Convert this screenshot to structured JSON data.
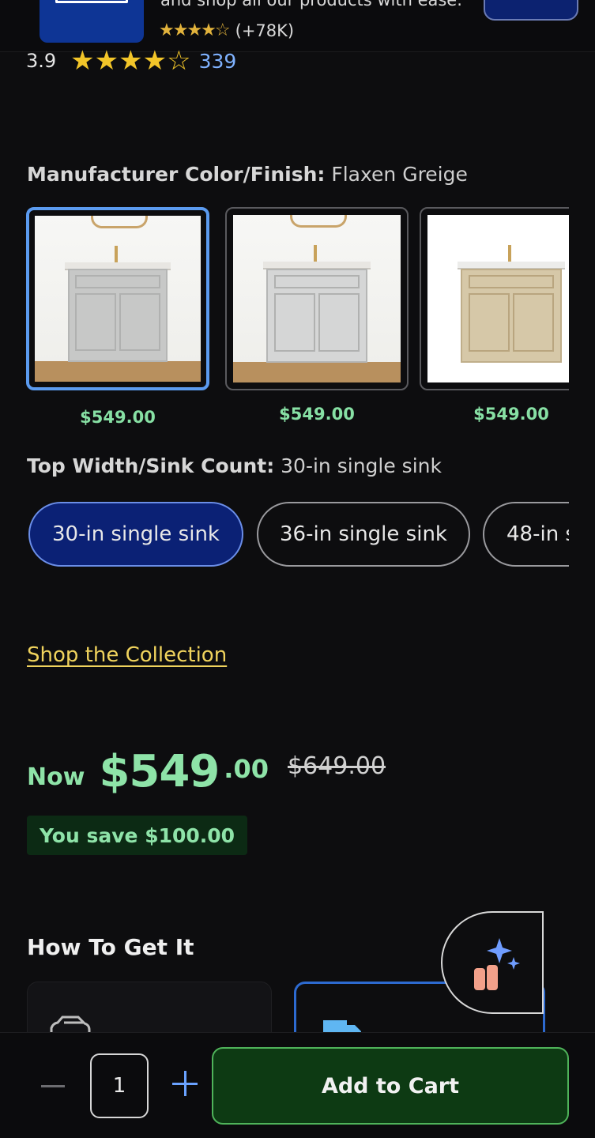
{
  "app_banner": {
    "text": "and shop all our products with ease.",
    "stars": "★★★★☆",
    "review_count": "(+78K)"
  },
  "rating": {
    "value": "3.9",
    "stars": "★★★★☆",
    "count": "339"
  },
  "color_finish": {
    "label": "Manufacturer Color/Finish:",
    "value": "Flaxen Greige",
    "options": [
      {
        "price": "$549.00",
        "selected": true
      },
      {
        "price": "$549.00",
        "selected": false
      },
      {
        "price": "$549.00",
        "selected": false
      }
    ]
  },
  "size": {
    "label": "Top Width/Sink Count:",
    "value": "30-in single sink",
    "options": [
      {
        "label": "30-in single sink",
        "selected": true
      },
      {
        "label": "36-in single sink",
        "selected": false
      },
      {
        "label": "48-in s",
        "selected": false
      }
    ]
  },
  "collection_link": "Shop the Collection",
  "price": {
    "now_label": "Now",
    "main": "$549",
    "cents": ".00",
    "was": "$649.00",
    "savings": "You save $100.00"
  },
  "fulfillment": {
    "title": "How To Get It"
  },
  "cart": {
    "quantity": "1",
    "add_label": "Add to Cart"
  },
  "colors": {
    "accent_price": "#8ee3a8",
    "link": "#f0d35d",
    "selected_pill": "#0b2175",
    "cart_button": "#0d3a13"
  }
}
